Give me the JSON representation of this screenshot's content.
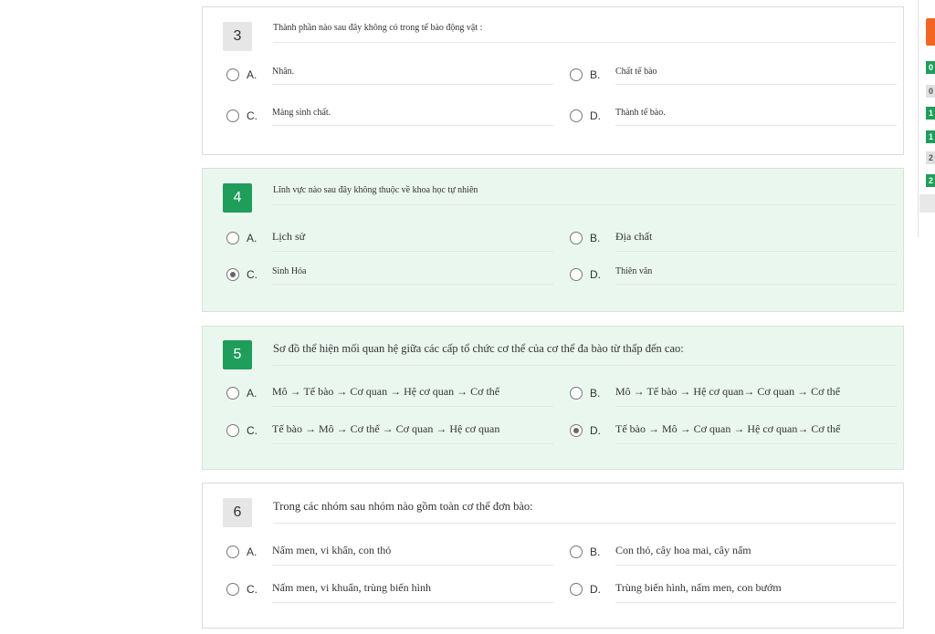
{
  "questions": [
    {
      "number": "3",
      "text": "Thành phần nào sau đây không có trong tế bào động vật :",
      "options": [
        {
          "label": "A.",
          "text": "Nhân."
        },
        {
          "label": "B.",
          "text": "Chất tế bào"
        },
        {
          "label": "C.",
          "text": "Màng sinh chất."
        },
        {
          "label": "D.",
          "text": "Thành tế bào."
        }
      ]
    },
    {
      "number": "4",
      "text": "Lĩnh vực nào sau đây không thuộc về khoa học tự nhiên",
      "options": [
        {
          "label": "A.",
          "text": "Lịch sử"
        },
        {
          "label": "B.",
          "text": "Địa chất"
        },
        {
          "label": "C.",
          "text": "Sinh Hóa"
        },
        {
          "label": "D.",
          "text": "Thiên văn"
        }
      ]
    },
    {
      "number": "5",
      "text": "Sơ đồ thể hiện mối quan hệ giữa các cấp tổ chức cơ thể của cơ thể đa bào từ thấp đến cao:",
      "options": [
        {
          "label": "A.",
          "text": "Mô → Tế bào → Cơ quan → Hệ cơ quan → Cơ thể"
        },
        {
          "label": "B.",
          "text": "Mô → Tế bào → Hệ cơ quan→ Cơ quan  → Cơ thể"
        },
        {
          "label": "C.",
          "text": "Tế bào → Mô → Cơ thể → Cơ quan → Hệ cơ quan"
        },
        {
          "label": "D.",
          "text": "Tế bào → Mô → Cơ quan → Hệ cơ quan→ Cơ thể"
        }
      ]
    },
    {
      "number": "6",
      "text": "Trong các nhóm sau nhóm nào gồm toàn cơ thể đơn bào:",
      "options": [
        {
          "label": "A.",
          "text": "Nấm men, vi khẩn, con thỏ"
        },
        {
          "label": "B.",
          "text": "Con thỏ, cây hoa mai, cây nấm"
        },
        {
          "label": "C.",
          "text": "Nấm men, vi khuẩn, trùng biến hình"
        },
        {
          "label": "D.",
          "text": "Trùng biến hình, nấm men, con bướm"
        }
      ]
    }
  ],
  "side_panel": {
    "chips": [
      "0",
      "0",
      "1",
      "1",
      "2",
      "2"
    ],
    "colors": {
      "accent": "#1e9e5a",
      "orange": "#f26522",
      "gray": "#e0e0e0"
    }
  }
}
